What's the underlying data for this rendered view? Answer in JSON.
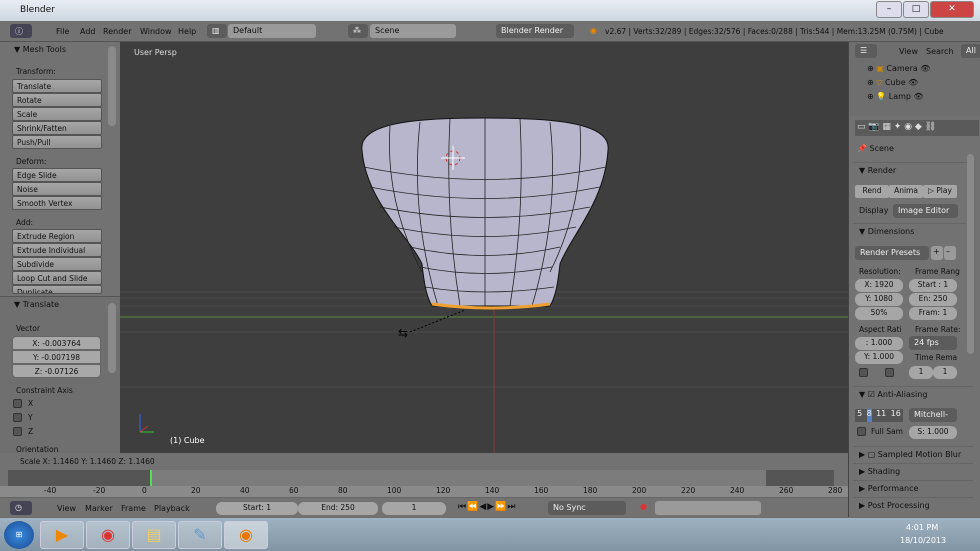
{
  "window": {
    "title": "Blender",
    "controls": [
      "–",
      "□",
      "✕"
    ]
  },
  "header": {
    "menus": [
      "File",
      "Add",
      "Render",
      "Window",
      "Help"
    ],
    "layout": "Default",
    "scene": "Scene",
    "engine": "Blender Render",
    "stats": "v2.67 | Verts:32/289 | Edges:32/576 | Faces:0/288 | Tris:544 | Mem:13.25M (0.75M) | Cube"
  },
  "tools": {
    "title": "Mesh Tools",
    "transform_label": "Transform:",
    "transform": [
      "Translate",
      "Rotate",
      "Scale",
      "Shrink/Fatten",
      "Push/Pull"
    ],
    "deform_label": "Deform:",
    "deform": [
      "Edge Slide",
      "Noise",
      "Smooth Vertex"
    ],
    "add_label": "Add:",
    "add": [
      "Extrude Region",
      "Extrude Individual",
      "Subdivide",
      "Loop Cut and Slide",
      "Duplicate"
    ]
  },
  "operator": {
    "title": "Translate",
    "vector_label": "Vector",
    "x": "X: -0.003764",
    "y": "Y: -0.007198",
    "z": "Z: -0.07126",
    "constraint_label": "Constraint Axis",
    "axes": [
      "X",
      "Y",
      "Z"
    ],
    "orientation_label": "Orientation"
  },
  "viewport": {
    "view_label": "User Persp",
    "object_label": "(1) Cube"
  },
  "status": {
    "scale": "Scale X: 1.1460  Y: 1.1460  Z: 1.1460"
  },
  "timeline": {
    "ticks": [
      "-40",
      "-20",
      "0",
      "20",
      "40",
      "60",
      "80",
      "100",
      "120",
      "140",
      "160",
      "180",
      "200",
      "220",
      "240",
      "260",
      "280"
    ],
    "menus": [
      "View",
      "Marker",
      "Frame",
      "Playback"
    ],
    "start": "Start: 1",
    "end": "End: 250",
    "current": "1",
    "sync": "No Sync"
  },
  "outliner": {
    "view": "View",
    "search": "Search",
    "all": "All",
    "items": [
      "Camera",
      "Cube",
      "Lamp"
    ]
  },
  "properties": {
    "scene": "Scene",
    "render_title": "Render",
    "render_btn": "Rend",
    "anim_btn": "Anima",
    "play_btn": "Play",
    "display_label": "Display",
    "display": "Image Editor",
    "dimensions_title": "Dimensions",
    "presets": "Render Presets",
    "resolution_label": "Resolution:",
    "res_x": "X: 1920",
    "res_y": "Y: 1080",
    "res_pct": "50%",
    "frame_range_label": "Frame Rang",
    "start": "Start : 1",
    "end": "En: 250",
    "frame": "Fram: 1",
    "aspect_label": "Aspect Rati",
    "aspect_x": ": 1.000",
    "aspect_y": "Y: 1.000",
    "frame_rate_label": "Frame Rate:",
    "fps": "24 fps",
    "time_remap_label": "Time Rema",
    "remap_old": "1",
    "remap_new": "1",
    "aa_title": "Anti-Aliasing",
    "aa_samples": [
      "5",
      "8",
      "11",
      "16"
    ],
    "filter": "Mitchell-",
    "full_sample": "Full Sam",
    "filter_size": "S: 1.000",
    "sections": [
      "Sampled Motion Blur",
      "Shading",
      "Performance",
      "Post Processing"
    ]
  },
  "taskbar": {
    "time": "4:01 PM",
    "date": "18/10/2013"
  }
}
